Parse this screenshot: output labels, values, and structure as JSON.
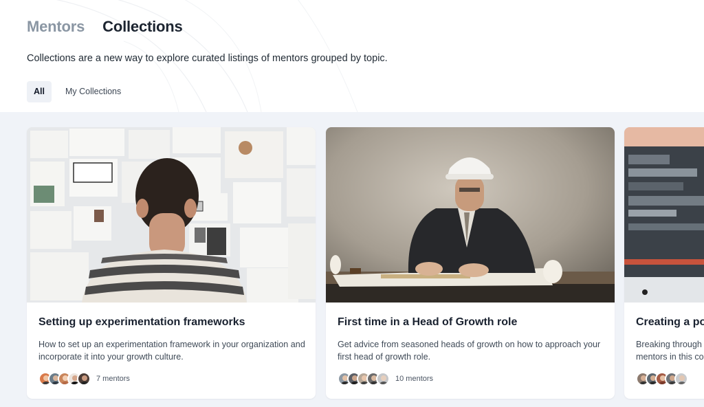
{
  "nav": {
    "tabs": [
      {
        "label": "Mentors",
        "active": false
      },
      {
        "label": "Collections",
        "active": true
      }
    ]
  },
  "header": {
    "subtitle": "Collections are a new way to explore curated listings of mentors grouped by topic."
  },
  "filters": [
    {
      "label": "All",
      "selected": true
    },
    {
      "label": "My Collections",
      "selected": false
    }
  ],
  "collections": [
    {
      "title": "Setting up experimentation frameworks",
      "description": "How to set up an experimentation framework in your organization and incorporate it into your growth culture.",
      "mentor_count_label": "7 mentors",
      "image": "person-facing-wall-of-sketches"
    },
    {
      "title": "First time in a Head of Growth role",
      "description": "Get advice from seasoned heads of growth on how to approach your first head of growth role.",
      "mentor_count_label": "10 mentors",
      "image": "man-in-hard-hat-drawing-plans"
    },
    {
      "title": "Creating a po",
      "description": "Breaking through mentors in this co",
      "mentor_count_label": "",
      "image": "computer-monitor-closeup"
    }
  ],
  "colors": {
    "page_bg": "#ffffff",
    "gallery_bg": "#f0f3f8",
    "inactive_tab": "#8a96a3",
    "active_tab": "#1c2430",
    "selected_filter_bg": "#eef1f6"
  }
}
